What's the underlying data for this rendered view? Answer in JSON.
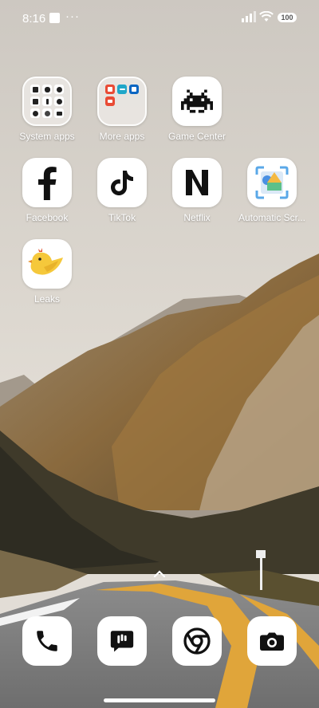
{
  "status_bar": {
    "time": "8:16",
    "more": "···",
    "battery": "100"
  },
  "apps": [
    {
      "name": "System apps",
      "icon": "folder-system-apps-icon"
    },
    {
      "name": "More apps",
      "icon": "folder-more-apps-icon"
    },
    {
      "name": "Game Center",
      "icon": "space-invader-icon"
    },
    {
      "name": "Facebook",
      "icon": "facebook-icon"
    },
    {
      "name": "TikTok",
      "icon": "tiktok-icon"
    },
    {
      "name": "Netflix",
      "icon": "netflix-icon"
    },
    {
      "name": "Automatic Scr...",
      "icon": "automatic-screenshot-icon"
    },
    {
      "name": "Leaks",
      "icon": "leaks-bird-icon"
    }
  ],
  "dock": [
    {
      "icon": "phone-icon"
    },
    {
      "icon": "messages-icon"
    },
    {
      "icon": "chrome-icon"
    },
    {
      "icon": "camera-icon"
    }
  ],
  "colors": {
    "icon_bg": "#ffffff",
    "label": "#ffffff",
    "leaks_bird": "#f5c83b"
  }
}
